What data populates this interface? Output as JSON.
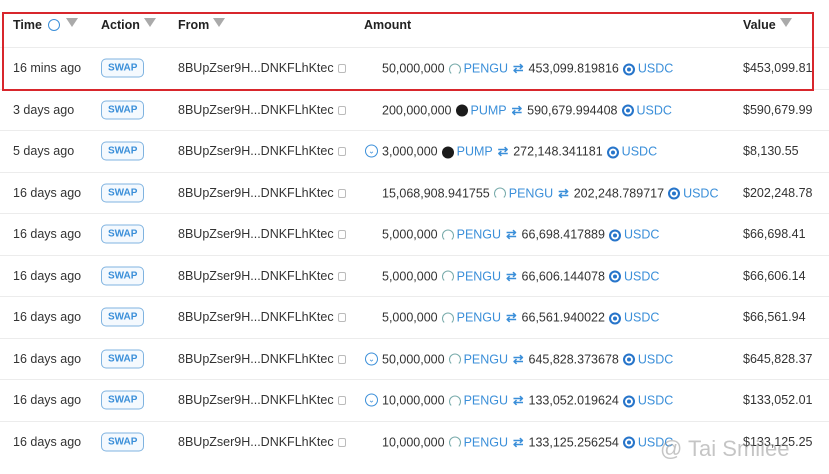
{
  "columns": {
    "time": "Time",
    "action": "Action",
    "from": "From",
    "amount": "Amount",
    "value": "Value"
  },
  "rows": [
    {
      "time": "16 mins ago",
      "action": "SWAP",
      "from": "8BUpZser9H...DNKFLhKtec",
      "chev": false,
      "amount_in": "50,000,000",
      "token_in": "PENGU",
      "icon_in": "pengu",
      "amount_out": "453,099.819816",
      "token_out": "USDC",
      "value": "$453,099.81"
    },
    {
      "time": "3 days ago",
      "action": "SWAP",
      "from": "8BUpZser9H...DNKFLhKtec",
      "chev": false,
      "amount_in": "200,000,000",
      "token_in": "PUMP",
      "icon_in": "pump",
      "amount_out": "590,679.994408",
      "token_out": "USDC",
      "value": "$590,679.99"
    },
    {
      "time": "5 days ago",
      "action": "SWAP",
      "from": "8BUpZser9H...DNKFLhKtec",
      "chev": true,
      "amount_in": "3,000,000",
      "token_in": "PUMP",
      "icon_in": "pump",
      "amount_out": "272,148.341181",
      "token_out": "USDC",
      "value": "$8,130.55"
    },
    {
      "time": "16 days ago",
      "action": "SWAP",
      "from": "8BUpZser9H...DNKFLhKtec",
      "chev": false,
      "amount_in": "15,068,908.941755",
      "token_in": "PENGU",
      "icon_in": "pengu",
      "amount_out": "202,248.789717",
      "token_out": "USDC",
      "value": "$202,248.78"
    },
    {
      "time": "16 days ago",
      "action": "SWAP",
      "from": "8BUpZser9H...DNKFLhKtec",
      "chev": false,
      "amount_in": "5,000,000",
      "token_in": "PENGU",
      "icon_in": "pengu",
      "amount_out": "66,698.417889",
      "token_out": "USDC",
      "value": "$66,698.41"
    },
    {
      "time": "16 days ago",
      "action": "SWAP",
      "from": "8BUpZser9H...DNKFLhKtec",
      "chev": false,
      "amount_in": "5,000,000",
      "token_in": "PENGU",
      "icon_in": "pengu",
      "amount_out": "66,606.144078",
      "token_out": "USDC",
      "value": "$66,606.14"
    },
    {
      "time": "16 days ago",
      "action": "SWAP",
      "from": "8BUpZser9H...DNKFLhKtec",
      "chev": false,
      "amount_in": "5,000,000",
      "token_in": "PENGU",
      "icon_in": "pengu",
      "amount_out": "66,561.940022",
      "token_out": "USDC",
      "value": "$66,561.94"
    },
    {
      "time": "16 days ago",
      "action": "SWAP",
      "from": "8BUpZser9H...DNKFLhKtec",
      "chev": true,
      "amount_in": "50,000,000",
      "token_in": "PENGU",
      "icon_in": "pengu",
      "amount_out": "645,828.373678",
      "token_out": "USDC",
      "value": "$645,828.37"
    },
    {
      "time": "16 days ago",
      "action": "SWAP",
      "from": "8BUpZser9H...DNKFLhKtec",
      "chev": true,
      "amount_in": "10,000,000",
      "token_in": "PENGU",
      "icon_in": "pengu",
      "amount_out": "133,052.019624",
      "token_out": "USDC",
      "value": "$133,052.01"
    },
    {
      "time": "16 days ago",
      "action": "SWAP",
      "from": "8BUpZser9H...DNKFLhKtec",
      "chev": false,
      "amount_in": "10,000,000",
      "token_in": "PENGU",
      "icon_in": "pengu",
      "amount_out": "133,125.256254",
      "token_out": "USDC",
      "value": "$133,125.25"
    }
  ],
  "watermark": "@ Tai Smilee",
  "colors": {
    "highlight": "#d8262c",
    "accent": "#3b8fd9"
  }
}
